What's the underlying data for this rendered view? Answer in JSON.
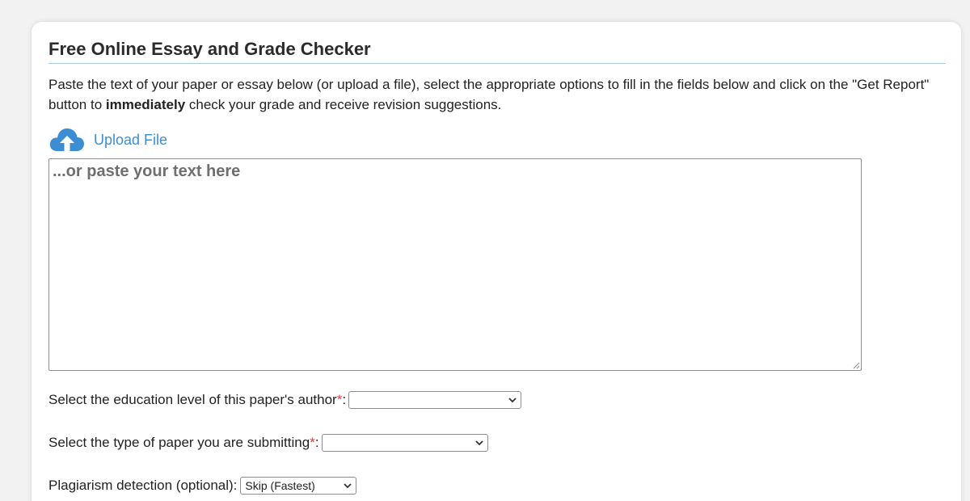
{
  "header": {
    "title": "Free Online Essay and Grade Checker"
  },
  "intro": {
    "part1": "Paste the text of your paper or essay below (or upload a file), select the appropriate options to fill in the fields below and click on the \"Get Report\" button to ",
    "emphasis": "immediately",
    "part2": " check your grade and receive revision suggestions."
  },
  "upload": {
    "label": "Upload File",
    "icon": "cloud-upload-icon"
  },
  "editor": {
    "placeholder": "...or paste your text here",
    "value": ""
  },
  "fields": {
    "education_level": {
      "label": "Select the education level of this paper's author",
      "required_mark": "*",
      "suffix": ":",
      "selected": ""
    },
    "paper_type": {
      "label": "Select the type of paper you are submitting",
      "required_mark": "*",
      "suffix": ":",
      "selected": ""
    },
    "plagiarism": {
      "label": "Plagiarism detection (optional):",
      "selected": "Skip (Fastest)"
    }
  },
  "colors": {
    "accent": "#3b8ed3",
    "required": "#e23b3b",
    "title_rule": "#a9cbe3"
  }
}
